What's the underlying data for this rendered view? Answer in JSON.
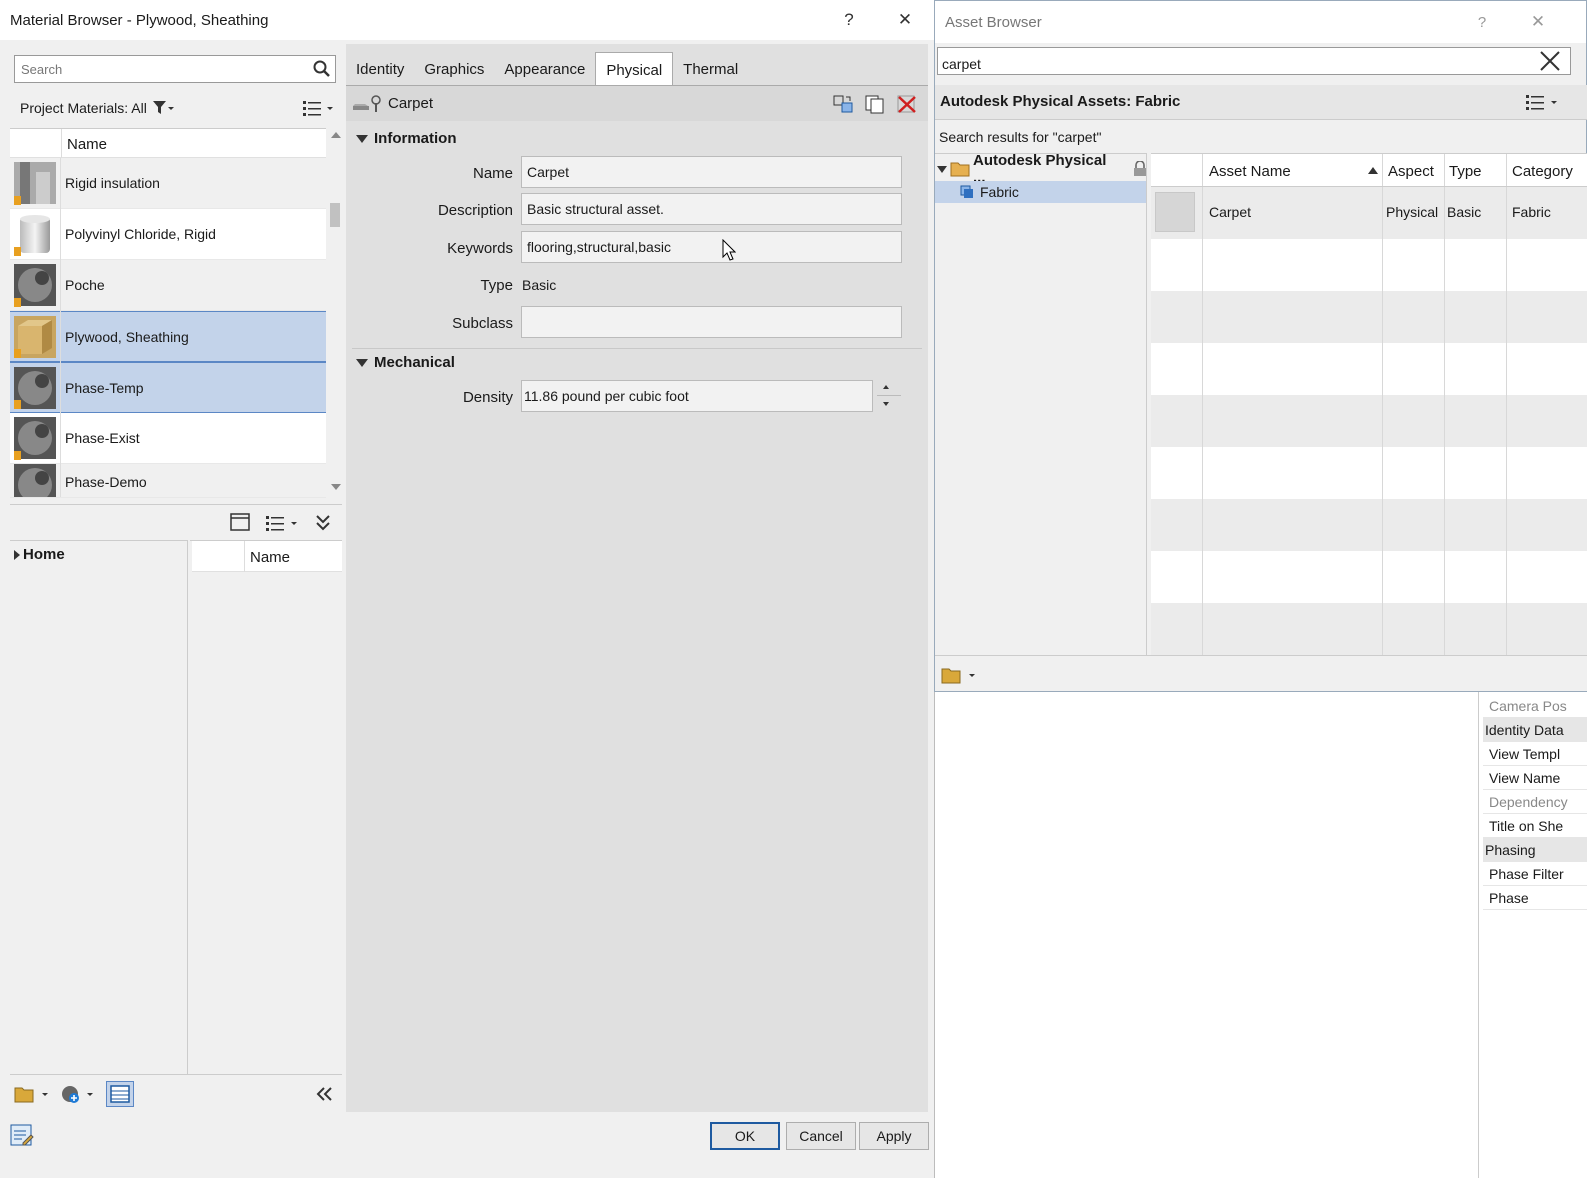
{
  "material_browser": {
    "title": "Material Browser - Plywood, Sheathing",
    "help_label": "?",
    "close_label": "✕",
    "search_placeholder": "Search",
    "library_filter": "Project Materials: All",
    "name_column": "Name",
    "materials": [
      {
        "name": "Rigid insulation",
        "selected": false
      },
      {
        "name": "Polyvinyl Chloride, Rigid",
        "selected": false
      },
      {
        "name": "Poche",
        "selected": false
      },
      {
        "name": "Plywood, Sheathing",
        "selected": true
      },
      {
        "name": "Phase-Temp",
        "selected": true
      },
      {
        "name": "Phase-Exist",
        "selected": false
      },
      {
        "name": "Phase-Demo",
        "selected": false
      }
    ],
    "library_tree_home": "Home",
    "library_name_column": "Name",
    "tabs": [
      "Identity",
      "Graphics",
      "Appearance",
      "Physical",
      "Thermal"
    ],
    "active_tab": "Physical",
    "asset_name": "Carpet",
    "information": {
      "header": "Information",
      "name_label": "Name",
      "name_value": "Carpet",
      "description_label": "Description",
      "description_value": "Basic structural asset.",
      "keywords_label": "Keywords",
      "keywords_value": "flooring,structural,basic",
      "type_label": "Type",
      "type_value": "Basic",
      "subclass_label": "Subclass",
      "subclass_value": ""
    },
    "mechanical": {
      "header": "Mechanical",
      "density_label": "Density",
      "density_value": "11.86 pound per cubic foot"
    },
    "buttons": {
      "ok": "OK",
      "cancel": "Cancel",
      "apply": "Apply"
    }
  },
  "asset_browser": {
    "title": "Asset Browser",
    "help_label": "?",
    "close_label": "✕",
    "search_value": "carpet",
    "header": "Autodesk Physical Assets: Fabric",
    "search_results": "Search results for \"carpet\"",
    "tree_root": "Autodesk Physical ...",
    "tree_child": "Fabric",
    "columns": [
      "Asset Name",
      "Aspect",
      "Type",
      "Category"
    ],
    "rows": [
      {
        "name": "Carpet",
        "aspect": "Physical",
        "type": "Basic",
        "category": "Fabric"
      }
    ]
  },
  "properties_panel": {
    "items": [
      {
        "label": "Camera Pos",
        "kind": "dim"
      },
      {
        "label": "Identity Data",
        "kind": "group"
      },
      {
        "label": "View Templ",
        "kind": "item"
      },
      {
        "label": "View Name",
        "kind": "item"
      },
      {
        "label": "Dependency",
        "kind": "dim"
      },
      {
        "label": "Title on She",
        "kind": "item"
      },
      {
        "label": "Phasing",
        "kind": "group"
      },
      {
        "label": "Phase Filter",
        "kind": "item"
      },
      {
        "label": "Phase",
        "kind": "item"
      }
    ]
  },
  "colors": {
    "selection": "#c3d3ea",
    "selection_border": "#5b87c5",
    "tree_selection": "#c3d3ea",
    "delete_red": "#d02020"
  }
}
